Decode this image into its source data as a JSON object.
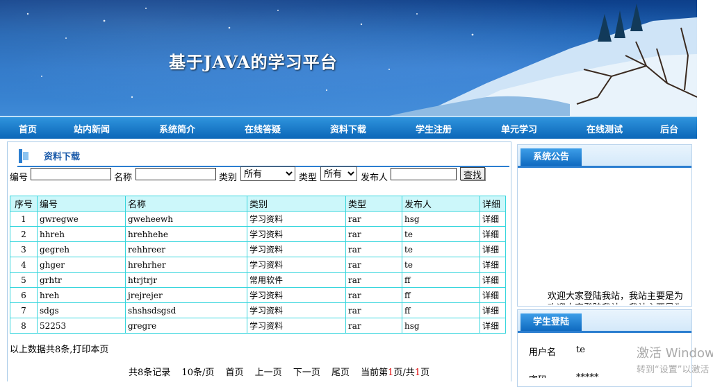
{
  "header": {
    "title": "基于JAVA的学习平台"
  },
  "nav": [
    "首页",
    "站内新闻",
    "系统简介",
    "在线答疑",
    "资料下载",
    "学生注册",
    "单元学习",
    "在线测试",
    "后台"
  ],
  "section": {
    "title": "资料下载"
  },
  "search": {
    "code_label": "编号",
    "code_value": "",
    "name_label": "名称",
    "name_value": "",
    "category_label": "类别",
    "category_selected": "所有",
    "type_label": "类型",
    "type_selected": "所有",
    "publisher_label": "发布人",
    "publisher_value": "",
    "search_button": "查找"
  },
  "table": {
    "headers": [
      "序号",
      "编号",
      "名称",
      "类别",
      "类型",
      "发布人",
      "详细"
    ],
    "rows": [
      [
        "1",
        "gwregwe",
        "gweheewh",
        "学习资料",
        "rar",
        "hsg",
        "详细"
      ],
      [
        "2",
        "hhreh",
        "hrehhehe",
        "学习资料",
        "rar",
        "te",
        "详细"
      ],
      [
        "3",
        "gegreh",
        "rehhreer",
        "学习资料",
        "rar",
        "te",
        "详细"
      ],
      [
        "4",
        "ghger",
        "hrehrher",
        "学习资料",
        "rar",
        "te",
        "详细"
      ],
      [
        "5",
        "grhtr",
        "htrjtrjr",
        "常用软件",
        "rar",
        "ff",
        "详细"
      ],
      [
        "6",
        "hreh",
        "jrejrejer",
        "学习资料",
        "rar",
        "ff",
        "详细"
      ],
      [
        "7",
        "sdgs",
        "shshsdsgsd",
        "学习资料",
        "rar",
        "ff",
        "详细"
      ],
      [
        "8",
        "52253",
        "gregre",
        "学习资料",
        "rar",
        "hsg",
        "详细"
      ]
    ]
  },
  "summary": "以上数据共8条,打印本页",
  "pager": {
    "total": "共8条记录",
    "per_page": "10条/页",
    "first": "首页",
    "prev": "上一页",
    "next": "下一页",
    "last": "尾页",
    "current_prefix": "当前第",
    "current_page": "1",
    "current_mid": "页/共",
    "total_pages": "1",
    "current_suffix": "页"
  },
  "notice": {
    "title": "系统公告",
    "text": "欢迎大家登陆我站，我站主要是为",
    "text2": "欢迎大家登陆我站，我站主要是为"
  },
  "login": {
    "title": "学生登陆",
    "username_label": "用户名",
    "username_value": "te",
    "password_label": "密码",
    "password_value": "*****"
  },
  "watermark": {
    "line1": "激活 Windows",
    "line2": "转到“设置”以激活"
  }
}
